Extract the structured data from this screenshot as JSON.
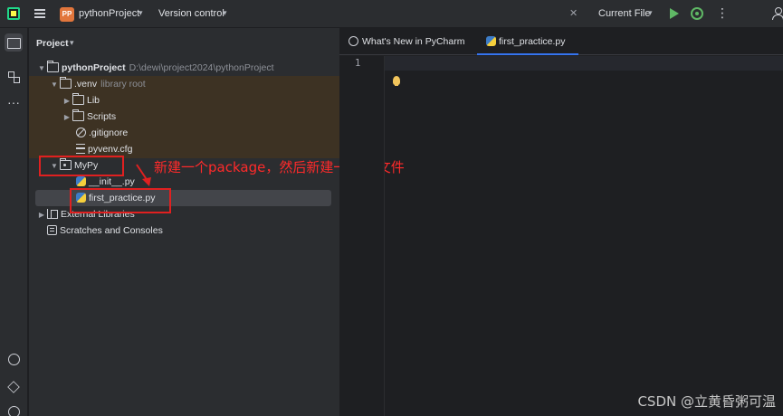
{
  "titlebar": {
    "project_badge": "PP",
    "project_name": "pythonProject",
    "version_control": "Version control",
    "run_config": "Current File",
    "caret": "▾",
    "more": "⋮"
  },
  "project_panel": {
    "title": "Project",
    "tree": {
      "root_name": "pythonProject",
      "root_path": "D:\\dewi\\project2024\\pythonProject",
      "venv_name": ".venv",
      "venv_hint": "library root",
      "lib": "Lib",
      "scripts": "Scripts",
      "gitignore": ".gitignore",
      "pyvenv": "pyvenv.cfg",
      "package": "MyPy",
      "init_file": "__init__.py",
      "practice_file": "first_practice.py",
      "external_libs": "External Libraries",
      "scratches": "Scratches and Consoles"
    }
  },
  "annotation": {
    "text": "新建一个package，然后新建一个py文件",
    "color": "#e02020"
  },
  "editor": {
    "tabs": [
      {
        "label": "What's New in PyCharm"
      },
      {
        "label": "first_practice.py"
      }
    ],
    "close_glyph": "✕",
    "line_number": "1"
  },
  "watermark": "CSDN @立黄昏粥可温",
  "colors": {
    "background": "#1e1f22",
    "panel": "#2b2d30",
    "accent": "#3574f0",
    "run_green": "#5fb865"
  }
}
